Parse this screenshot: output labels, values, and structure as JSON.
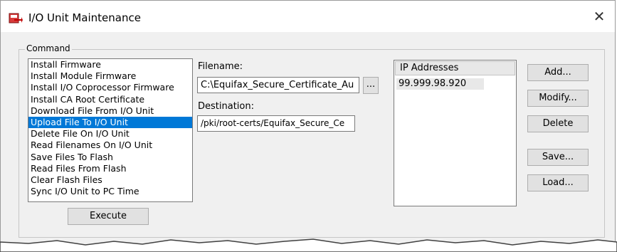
{
  "window": {
    "title": "I/O Unit Maintenance",
    "close_glyph": "✕",
    "icon": "app-transfer-icon"
  },
  "command": {
    "group_label": "Command",
    "items": [
      "Install Firmware",
      "Install Module Firmware",
      "Install I/O Coprocessor Firmware",
      "Install CA Root Certificate",
      "Download File From I/O Unit",
      "Upload File To I/O Unit",
      "Delete File On I/O Unit",
      "Read Filenames On I/O Unit",
      "Save Files To Flash",
      "Read Files From Flash",
      "Clear Flash Files",
      "Sync I/O Unit to PC Time"
    ],
    "selected": "Upload File To I/O Unit",
    "execute_label": "Execute"
  },
  "filename": {
    "label": "Filename:",
    "value": "C:\\Equifax_Secure_Certificate_Au",
    "browse_label": "..."
  },
  "destination": {
    "label": "Destination:",
    "value": "/pki/root-certs/Equifax_Secure_Ce"
  },
  "ip_addresses": {
    "header": "IP Addresses",
    "rows": [
      "99.999.98.920"
    ]
  },
  "buttons": {
    "add": "Add...",
    "modify": "Modify...",
    "delete": "Delete",
    "save": "Save...",
    "load": "Load..."
  },
  "colors": {
    "selection": "#0078d7",
    "dialog_bg": "#f0f0f0",
    "title_bg": "#ffffff"
  }
}
